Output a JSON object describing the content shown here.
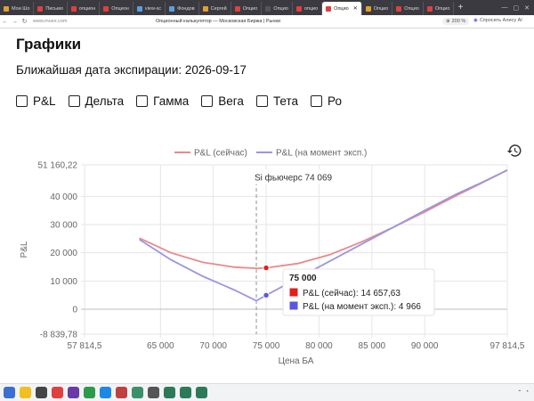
{
  "browser": {
    "tabs": [
      {
        "label": "Мои Шо",
        "color": "#e0a030",
        "active": false
      },
      {
        "label": "Письмо",
        "color": "#e04040",
        "active": false
      },
      {
        "label": "опцион",
        "color": "#e04040",
        "active": false
      },
      {
        "label": "Опцион",
        "color": "#e04040",
        "active": false
      },
      {
        "label": "view-sc",
        "color": "#5aa0e0",
        "active": false
      },
      {
        "label": "Фондов",
        "color": "#5aa0e0",
        "active": false
      },
      {
        "label": "Сергей",
        "color": "#e0a030",
        "active": false
      },
      {
        "label": "Опцио",
        "color": "#e04040",
        "active": false
      },
      {
        "label": "Опцио",
        "color": "#555555",
        "active": false
      },
      {
        "label": "опцио",
        "color": "#e04040",
        "active": false
      },
      {
        "label": "Опцио",
        "color": "#e04040",
        "active": true
      },
      {
        "label": "Опцио",
        "color": "#e0a030",
        "active": false
      },
      {
        "label": "Опцио",
        "color": "#e04040",
        "active": false
      },
      {
        "label": "Опцио",
        "color": "#e04040",
        "active": false
      }
    ],
    "url": "www.moex.com",
    "page_title": "Опционный калькулятор — Московская Биржа | Рынки",
    "zoom": "200 %",
    "ask_label": "Спросить Алису AI"
  },
  "page": {
    "title": "Графики",
    "expiry_text": "Ближайшая дата экспирации: 2026-09-17",
    "checkboxes": [
      "P&L",
      "Дельта",
      "Гамма",
      "Вега",
      "Тета",
      "Ро"
    ]
  },
  "tooltip": {
    "x_label": "75 000",
    "line1": "P&L (сейчас): 14 657,63",
    "line2": "P&L (на момент эксп.): 4 966"
  },
  "annotation": "Si фьючерс 74 069",
  "colors": {
    "now": "#e8898c",
    "expiry": "#9a96e0",
    "marker_now": "#e31c1c",
    "marker_expiry": "#5b57e0"
  },
  "chart_data": {
    "type": "line",
    "title": "",
    "xlabel": "Цена БА",
    "ylabel": "P&L",
    "xlim": [
      57814.5,
      97814.5
    ],
    "ylim": [
      -8839.78,
      51160.22
    ],
    "x_ticks": [
      57814.5,
      65000,
      70000,
      75000,
      80000,
      85000,
      90000,
      97814.5
    ],
    "x_tick_labels": [
      "57 814,5",
      "65 000",
      "70 000",
      "75 000",
      "80 000",
      "85 000",
      "90 000",
      "97 814,5"
    ],
    "y_ticks": [
      -8839.78,
      0,
      10000,
      20000,
      30000,
      40000,
      51160.22
    ],
    "y_tick_labels": [
      "-8 839,78",
      "0",
      "10 000",
      "20 000",
      "30 000",
      "40 000",
      "51 160,22"
    ],
    "legend_position": "top",
    "futures_price": 74069,
    "series": [
      {
        "name": "P&L (сейчас)",
        "x": [
          63000,
          66000,
          69000,
          72000,
          74069,
          75000,
          78000,
          81000,
          84000,
          87000,
          90000,
          93000,
          95000,
          97814.5
        ],
        "y": [
          25200,
          20000,
          16600,
          14900,
          14500,
          14657.63,
          16200,
          19300,
          23800,
          29000,
          34500,
          40300,
          44000,
          49300
        ]
      },
      {
        "name": "P&L (на момент эксп.)",
        "x": [
          63000,
          66000,
          69000,
          72000,
          74069,
          75000,
          78000,
          81000,
          84000,
          87000,
          90000,
          93000,
          95000,
          97814.5
        ],
        "y": [
          24700,
          17500,
          11700,
          6800,
          3000,
          4966,
          11000,
          17000,
          23000,
          29000,
          35000,
          40800,
          44200,
          49300
        ]
      }
    ],
    "highlight_x": 75000
  },
  "taskbar": {
    "clock_icon": "clock-icon",
    "items": [
      "#3b6fd1",
      "#f0c020",
      "#444444",
      "#e04040",
      "#6a3aa8",
      "#2c9a4a",
      "#1e88e5",
      "#c04040",
      "#3b8f6a",
      "#555555",
      "#2c7a5a",
      "#2c7a5a",
      "#2c7a5a"
    ]
  }
}
